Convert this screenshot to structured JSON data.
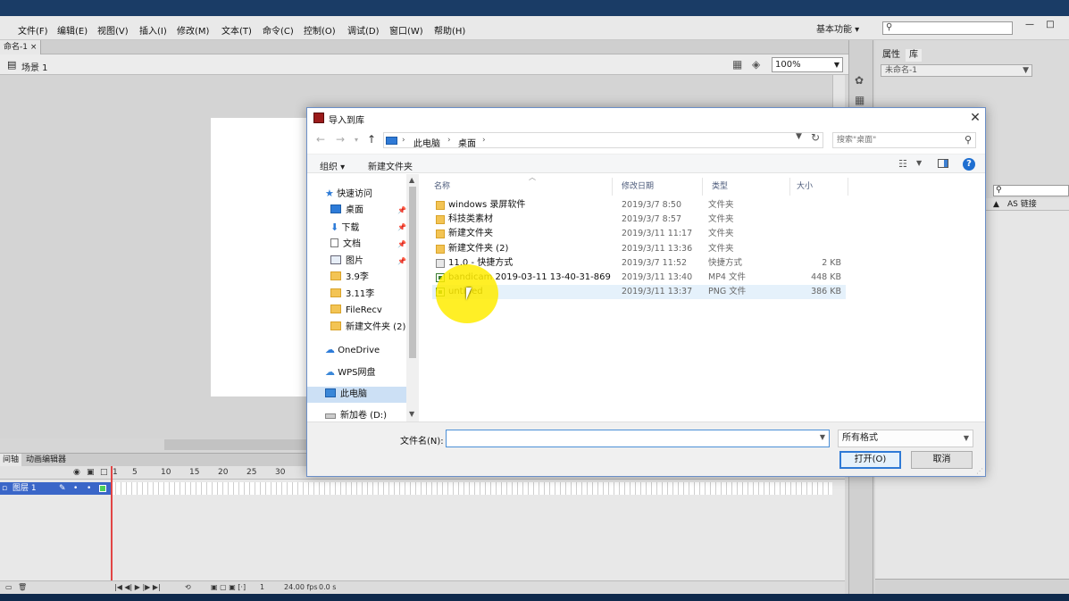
{
  "app": {
    "menu": [
      "文件(F)",
      "编辑(E)",
      "视图(V)",
      "插入(I)",
      "修改(M)",
      "文本(T)",
      "命令(C)",
      "控制(O)",
      "调试(D)",
      "窗口(W)",
      "帮助(H)"
    ],
    "workspace": "基本功能",
    "document_tab": "命名-1",
    "scene": "场景 1",
    "zoom": "100%",
    "timeline_tabs": [
      "间轴",
      "动画编辑器"
    ],
    "frame_numbers": [
      "1",
      "5",
      "10",
      "15",
      "20",
      "25",
      "30"
    ],
    "layer_name": "图层 1",
    "footer": {
      "frame": "1",
      "fps": "24.00 fps",
      "time": "0.0 s"
    },
    "right_panel": {
      "tabs": [
        "属性",
        "库"
      ],
      "library_doc": "未命名-1",
      "linkage_header": "AS 链接"
    }
  },
  "dialog": {
    "title": "导入到库",
    "breadcrumbs": [
      "此电脑",
      "桌面"
    ],
    "search_placeholder": "搜索\"桌面\"",
    "commands": {
      "organize": "组织",
      "new_folder": "新建文件夹"
    },
    "nav_pane": [
      {
        "label": "快速访问",
        "icon": "star-icon",
        "indent": 0,
        "pinned": false
      },
      {
        "label": "桌面",
        "icon": "desktop-icon",
        "indent": 1,
        "pinned": true
      },
      {
        "label": "下载",
        "icon": "download-icon",
        "indent": 1,
        "pinned": true
      },
      {
        "label": "文档",
        "icon": "document-icon",
        "indent": 1,
        "pinned": true
      },
      {
        "label": "图片",
        "icon": "pictures-icon",
        "indent": 1,
        "pinned": true
      },
      {
        "label": "3.9李",
        "icon": "folder-icon",
        "indent": 1,
        "pinned": false
      },
      {
        "label": "3.11李",
        "icon": "folder-icon",
        "indent": 1,
        "pinned": false
      },
      {
        "label": "FileRecv",
        "icon": "folder-icon",
        "indent": 1,
        "pinned": false
      },
      {
        "label": "新建文件夹 (2)",
        "icon": "folder-icon",
        "indent": 1,
        "pinned": false
      },
      {
        "label": "OneDrive",
        "icon": "cloud-icon",
        "indent": 0,
        "pinned": false
      },
      {
        "label": "WPS网盘",
        "icon": "wps-cloud-icon",
        "indent": 0,
        "pinned": false
      },
      {
        "label": "此电脑",
        "icon": "computer-icon",
        "indent": 0,
        "pinned": false,
        "selected": true
      },
      {
        "label": "新加卷 (D:)",
        "icon": "drive-icon",
        "indent": 0,
        "pinned": false
      }
    ],
    "columns": {
      "name": "名称",
      "date": "修改日期",
      "type": "类型",
      "size": "大小"
    },
    "files": [
      {
        "name": "windows 录屏软件",
        "date": "2019/3/7 8:50",
        "type": "文件夹",
        "size": "",
        "kind": "folder"
      },
      {
        "name": "科技类素材",
        "date": "2019/3/7 8:57",
        "type": "文件夹",
        "size": "",
        "kind": "folder"
      },
      {
        "name": "新建文件夹",
        "date": "2019/3/11 11:17",
        "type": "文件夹",
        "size": "",
        "kind": "folder"
      },
      {
        "name": "新建文件夹 (2)",
        "date": "2019/3/11 13:36",
        "type": "文件夹",
        "size": "",
        "kind": "folder"
      },
      {
        "name": "11.0 - 快捷方式",
        "date": "2019/3/7 11:52",
        "type": "快捷方式",
        "size": "2 KB",
        "kind": "lnk"
      },
      {
        "name": "bandicam 2019-03-11 13-40-31-869",
        "date": "2019/3/11 13:40",
        "type": "MP4 文件",
        "size": "448 KB",
        "kind": "media"
      },
      {
        "name": "untitled",
        "date": "2019/3/11 13:37",
        "type": "PNG 文件",
        "size": "386 KB",
        "kind": "media",
        "hover": true
      }
    ],
    "filename_label": "文件名(N):",
    "filename_value": "",
    "filetype": "所有格式",
    "open_button": "打开(O)",
    "cancel_button": "取消"
  }
}
